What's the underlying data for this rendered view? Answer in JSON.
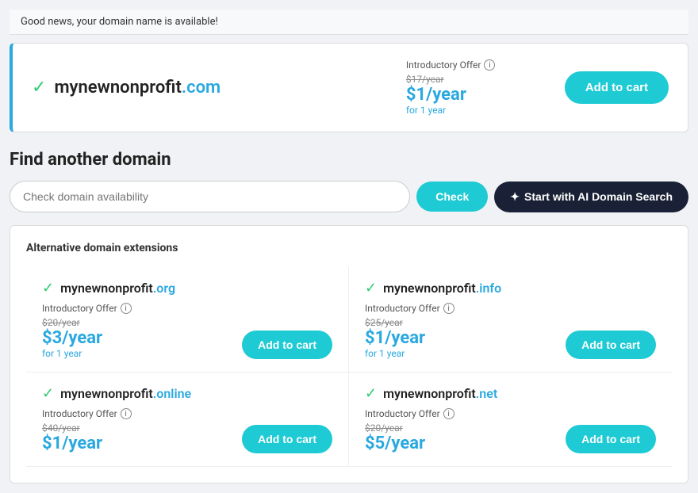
{
  "banner": {
    "text": "Good news, your domain name is available!"
  },
  "mainDomain": {
    "name": "mynewnonprofit",
    "tld": ".com",
    "introLabel": "Introductory Offer",
    "originalPrice": "$17/year",
    "salePrice": "$1/year",
    "period": "for 1 year",
    "cartLabel": "Add to cart"
  },
  "findAnother": {
    "title": "Find another domain",
    "searchPlaceholder": "Check domain availability",
    "checkLabel": "Check",
    "aiLabel": "Start with AI Domain Search"
  },
  "alternatives": {
    "sectionTitle": "Alternative domain extensions",
    "items": [
      {
        "name": "mynewnonprofit",
        "tld": ".org",
        "introLabel": "Introductory Offer",
        "originalPrice": "$20/year",
        "salePrice": "$3/year",
        "period": "for 1 year",
        "cartLabel": "Add to cart"
      },
      {
        "name": "mynewnonprofit",
        "tld": ".info",
        "introLabel": "Introductory Offer",
        "originalPrice": "$25/year",
        "salePrice": "$1/year",
        "period": "for 1 year",
        "cartLabel": "Add to cart"
      },
      {
        "name": "mynewnonprofit",
        "tld": ".online",
        "introLabel": "Introductory Offer",
        "originalPrice": "$40/year",
        "salePrice": "$1/year",
        "period": "",
        "cartLabel": "Add to cart"
      },
      {
        "name": "mynewnonprofit",
        "tld": ".net",
        "introLabel": "Introductory Offer",
        "originalPrice": "$20/year",
        "salePrice": "$5/year",
        "period": "",
        "cartLabel": "Add to cart"
      }
    ]
  },
  "icons": {
    "check": "✓",
    "info": "i",
    "ai": "✦"
  }
}
